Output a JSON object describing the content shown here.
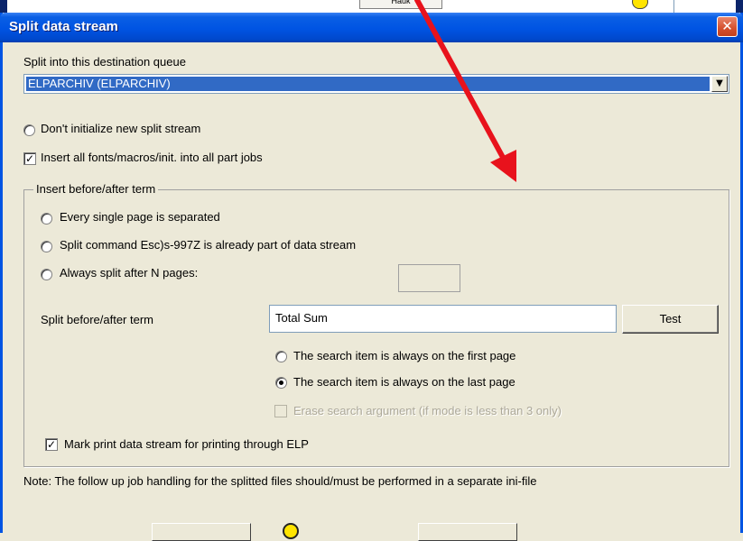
{
  "background": {
    "button_label": "Hauk"
  },
  "dialog": {
    "title": "Split data stream",
    "close_symbol": "✕",
    "destination_label": "Split into this destination queue",
    "destination_value": "ELPARCHIV (ELPARCHIV)",
    "dont_initialize_label": "Don't initialize new split stream",
    "insert_fonts_label": "Insert all fonts/macros/init. into all part jobs",
    "insert_fonts_checked": true,
    "group": {
      "legend": "Insert before/after term",
      "every_page_label": "Every single page is separated",
      "split_command_label": "Split command Esc)s-997Z is already part of data stream",
      "always_split_label": "Always split after N pages:",
      "n_pages_value": "",
      "term_label": "Split before/after term",
      "term_value": "Total Sum",
      "test_button": "Test",
      "first_page_label": "The search item is always on the first page",
      "last_page_label": "The search item is always on the last page",
      "selected_position": "last",
      "erase_label": "Erase search argument (if mode is less than 3 only)",
      "erase_checked": false,
      "mark_print_label": "Mark print data stream for printing through ELP",
      "mark_print_checked": true
    },
    "note": "Note: The follow up job handling for the splitted files should/must be performed in a separate ini-file"
  },
  "colors": {
    "titlebar": "#0054e3",
    "selection": "#316ac5",
    "annotation_arrow": "#e8121c",
    "highlight_circle": "#ffe400"
  }
}
